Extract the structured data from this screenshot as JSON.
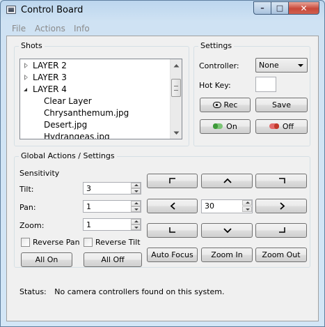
{
  "window": {
    "title": "Control Board",
    "controls": {
      "minimize": "–",
      "maximize": "□",
      "close": "✕"
    }
  },
  "menu": [
    "File",
    "Actions",
    "Info"
  ],
  "shots": {
    "group_title": "Shots",
    "tree": [
      {
        "label": "LAYER 2",
        "state": "collapsed",
        "level": 0
      },
      {
        "label": "LAYER 3",
        "state": "collapsed",
        "level": 0
      },
      {
        "label": "LAYER 4",
        "state": "expanded",
        "level": 0
      },
      {
        "label": "Clear Layer",
        "level": 1
      },
      {
        "label": "Chrysanthemum.jpg",
        "level": 1
      },
      {
        "label": "Desert.jpg",
        "level": 1
      },
      {
        "label": "Hydrangeas.jpg",
        "level": 1
      }
    ]
  },
  "settings": {
    "group_title": "Settings",
    "controller_label": "Controller:",
    "controller_value": "None",
    "hotkey_label": "Hot Key:",
    "hotkey_value": "",
    "rec_label": "Rec",
    "save_label": "Save",
    "on_label": "On",
    "off_label": "Off"
  },
  "global": {
    "group_title": "Global Actions / Settings",
    "sensitivity_label": "Sensitivity",
    "tilt_label": "Tilt:",
    "tilt_value": "3",
    "pan_label": "Pan:",
    "pan_value": "1",
    "zoom_label": "Zoom:",
    "zoom_value": "1",
    "reverse_pan_label": "Reverse Pan",
    "reverse_tilt_label": "Reverse Tilt",
    "all_on_label": "All On",
    "all_off_label": "All Off",
    "speed_value": "30",
    "auto_focus_label": "Auto Focus",
    "zoom_in_label": "Zoom In",
    "zoom_out_label": "Zoom Out"
  },
  "status": {
    "label": "Status:",
    "message": "No camera controllers found on this system."
  }
}
